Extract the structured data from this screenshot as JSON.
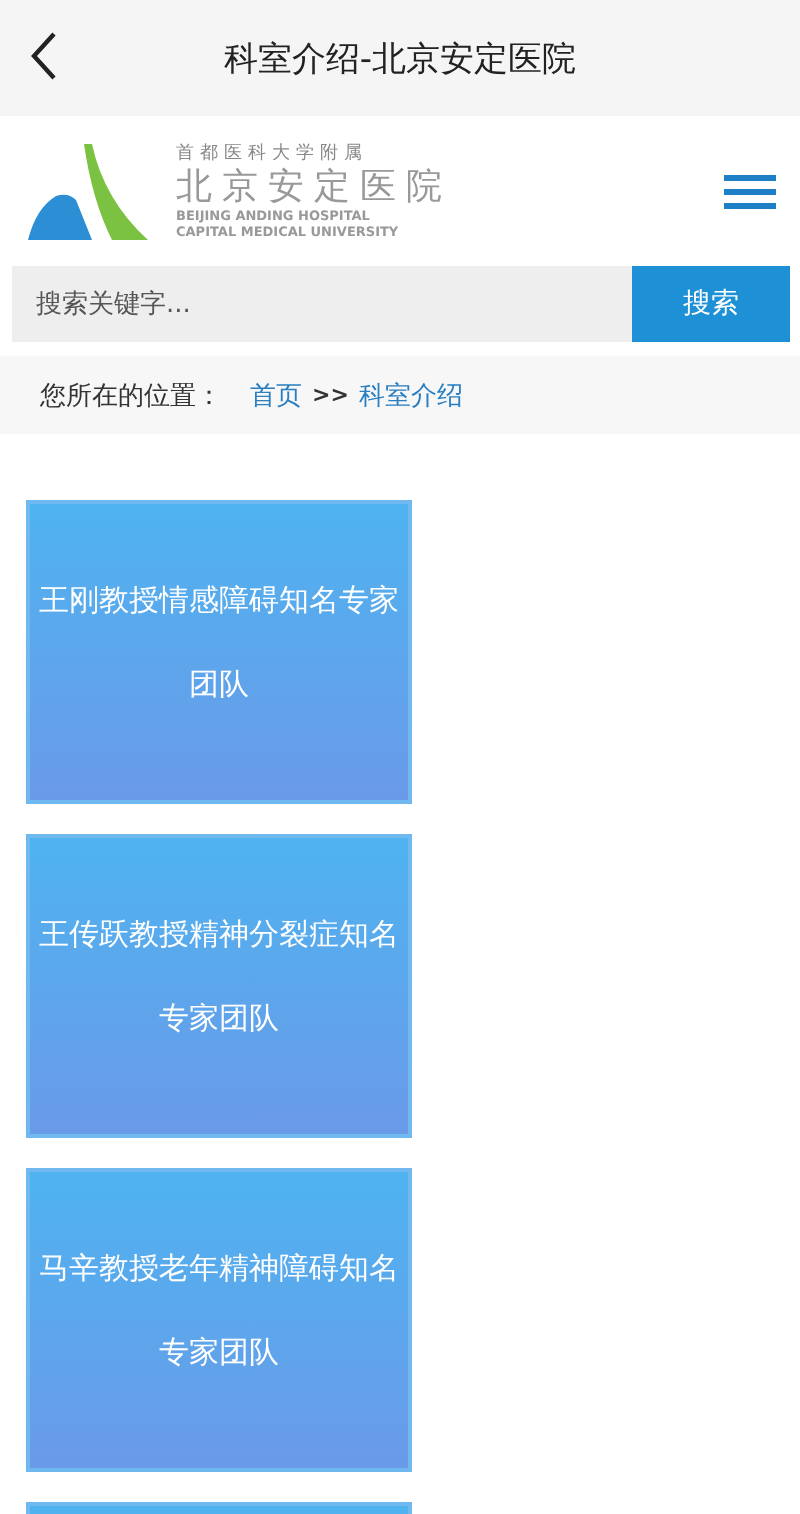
{
  "nav_bar": {
    "title": "科室介绍-北京安定医院"
  },
  "header": {
    "logo": {
      "affiliation": "首都医科大学附属",
      "name": "北京安定医院",
      "english_1": "BEIJING ANDING HOSPITAL",
      "english_2": "CAPITAL MEDICAL UNIVERSITY"
    }
  },
  "search": {
    "placeholder": "搜索关键字...",
    "button": "搜索"
  },
  "breadcrumb": {
    "label": "您所在的位置：",
    "links": [
      "首页",
      "科室介绍"
    ],
    "separator": ">>"
  },
  "cards": [
    {
      "kind": "full",
      "title": "王刚教授情感障碍知名专家团队"
    },
    {
      "kind": "full",
      "title": "王传跃教授精神分裂症知名专家团队"
    },
    {
      "kind": "full",
      "title": "马辛教授老年精神障碍知名专家团队"
    },
    {
      "kind": "cut"
    }
  ]
}
